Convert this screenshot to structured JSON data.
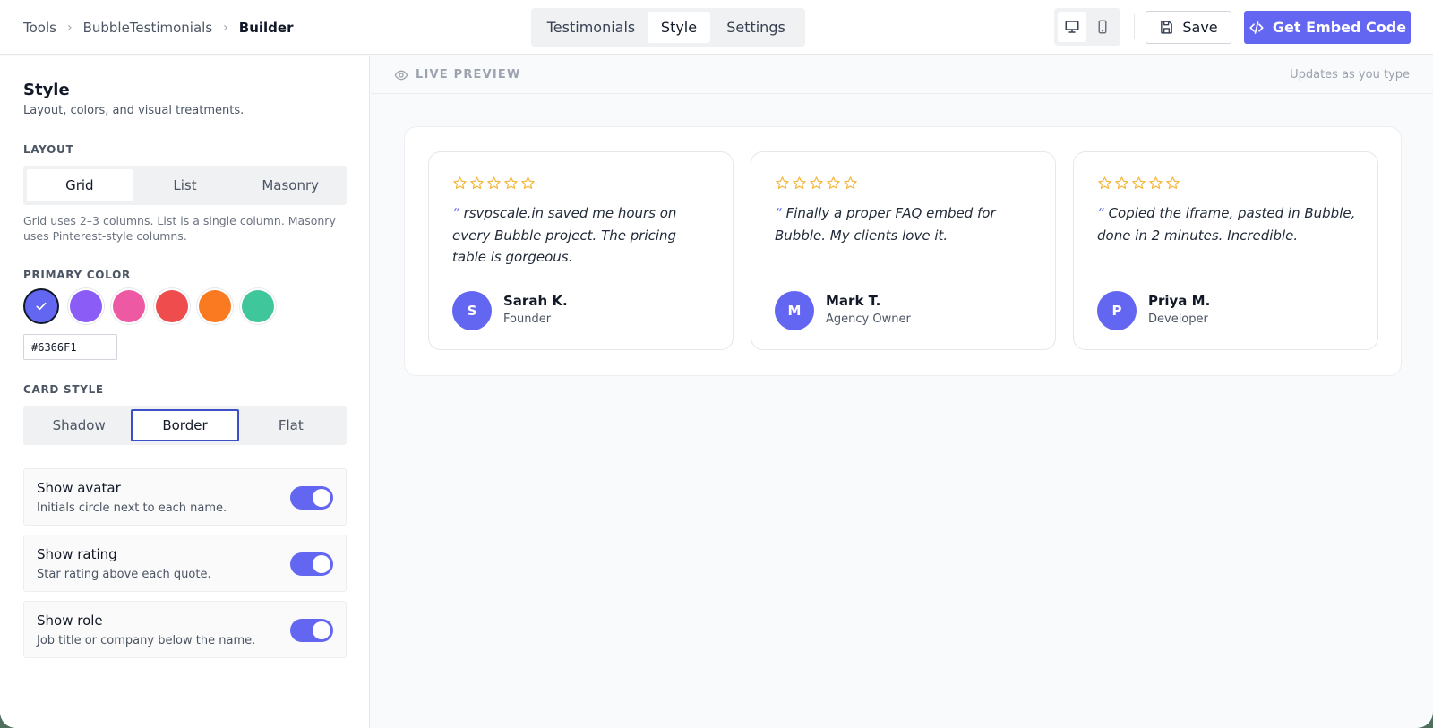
{
  "breadcrumb": [
    "Tools",
    "BubbleTestimonials",
    "Builder"
  ],
  "tabs": [
    "Testimonials",
    "Style",
    "Settings"
  ],
  "active_tab": "Style",
  "device": {
    "desktop_icon": "monitor-icon",
    "mobile_icon": "phone-icon",
    "active": "desktop"
  },
  "save_label": "Save",
  "embed_label": "Get Embed Code",
  "sidebar": {
    "title": "Style",
    "subtitle": "Layout, colors, and visual treatments.",
    "layout": {
      "label": "LAYOUT",
      "options": [
        "Grid",
        "List",
        "Masonry"
      ],
      "selected": "Grid",
      "help": "Grid uses 2–3 columns. List is a single column. Masonry uses Pinterest-style columns."
    },
    "primary_color": {
      "label": "PRIMARY COLOR",
      "swatches": [
        "#6366F1",
        "#8B5CF6",
        "#EC4899",
        "#EF4444",
        "#F97316",
        "#10B981"
      ],
      "selected": "#6366F1",
      "hex_value": "#6366F1"
    },
    "card_style": {
      "label": "CARD STYLE",
      "options": [
        "Shadow",
        "Border",
        "Flat"
      ],
      "selected": "Border"
    },
    "toggles": [
      {
        "label": "Show avatar",
        "desc": "Initials circle next to each name.",
        "on": true
      },
      {
        "label": "Show rating",
        "desc": "Star rating above each quote.",
        "on": true
      },
      {
        "label": "Show role",
        "desc": "Job title or company below the name.",
        "on": true
      }
    ]
  },
  "preview": {
    "label": "LIVE PREVIEW",
    "note": "Updates as you type",
    "quote_mark": "“",
    "accent": "#6366F1",
    "star_color": "#F5B942",
    "cards": [
      {
        "quote": "rsvpscale.in saved me hours on every Bubble project. The pricing table is gorgeous.",
        "initial": "S",
        "name": "Sarah K.",
        "role": "Founder",
        "stars": 5
      },
      {
        "quote": "Finally a proper FAQ embed for Bubble. My clients love it.",
        "initial": "M",
        "name": "Mark T.",
        "role": "Agency Owner",
        "stars": 5
      },
      {
        "quote": "Copied the iframe, pasted in Bubble, done in 2 minutes. Incredible.",
        "initial": "P",
        "name": "Priya M.",
        "role": "Developer",
        "stars": 5
      }
    ]
  }
}
